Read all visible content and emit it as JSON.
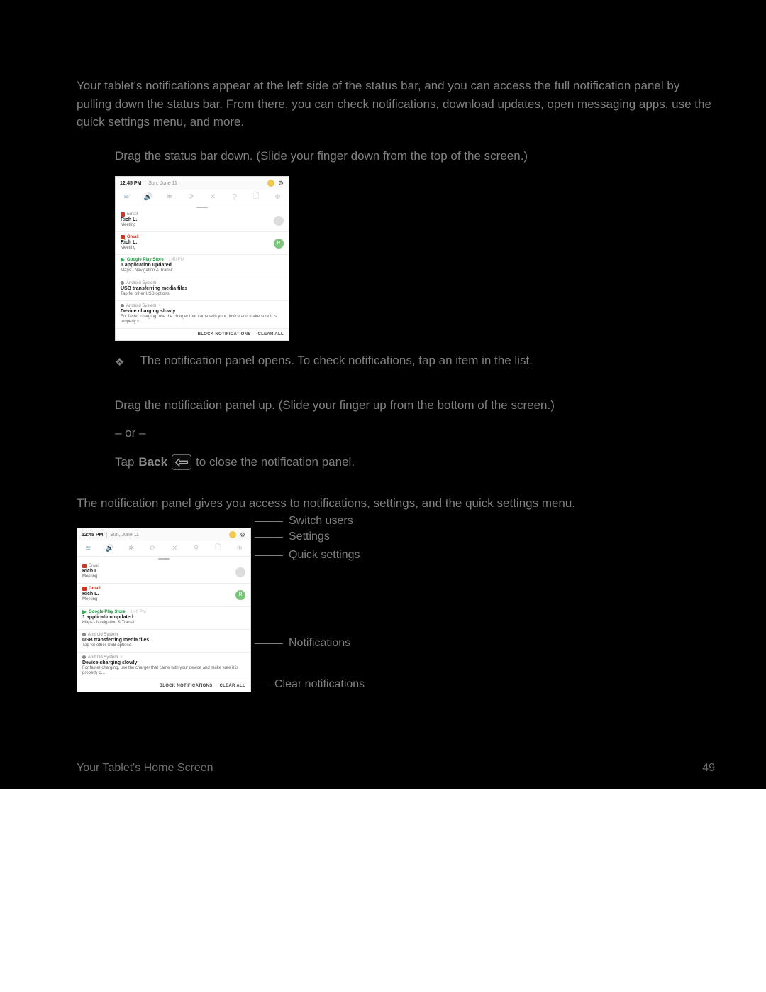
{
  "intro": "Your tablet's notifications appear at the left side of the status bar, and you can access the full notification panel by pulling down the status bar. From there, you can check notifications, download updates, open messaging apps, use the quick settings menu, and more.",
  "open": {
    "step": "Drag the status bar down. (Slide your finger down from the top of the screen.)",
    "result": "The notification panel opens. To check notifications, tap an item in the list."
  },
  "close": {
    "step": "Drag the notification panel up. (Slide your finger up from the bottom of the screen.)",
    "or": "– or –",
    "tap_pre": "Tap",
    "tap_bold": "Back",
    "tap_post": "to close the notification panel."
  },
  "layout_intro": "The notification panel gives you access to notifications, settings, and the quick settings menu.",
  "callouts": {
    "switch_users": "Switch users",
    "settings": "Settings",
    "quick_settings": "Quick settings",
    "notifications": "Notifications",
    "clear": "Clear notifications"
  },
  "panel": {
    "time": "12:45 PM",
    "date": "Sun, June 11",
    "notifs": [
      {
        "app": "Email",
        "appClass": "email",
        "title": "Rich L.",
        "body": "Meeting",
        "avatar": "",
        "avatarClass": ""
      },
      {
        "app": "Gmail",
        "appClass": "gmail",
        "appColor": "red",
        "title": "Rich L.",
        "body": "Meeting",
        "avatar": "R",
        "avatarClass": "green"
      },
      {
        "app": "Google Play Store",
        "appClass": "play",
        "appColor": "green",
        "meta": "1:40 PM",
        "title": "1 application updated",
        "body": "Maps - Navigation & Transit"
      },
      {
        "app": "Android System",
        "appClass": "sys",
        "appColor": "gray",
        "title": "USB transferring media files",
        "body": "Tap for other USB options."
      },
      {
        "app": "Android System",
        "appClass": "sys",
        "appColor": "gray",
        "chev": true,
        "title": "Device charging slowly",
        "body": "For faster charging, use the charger that came with your device and make sure it is properly c…"
      }
    ],
    "actions": {
      "block": "BLOCK NOTIFICATIONS",
      "clear": "CLEAR ALL"
    }
  },
  "footer": {
    "left": "Your Tablet's Home Screen",
    "right": "49"
  }
}
